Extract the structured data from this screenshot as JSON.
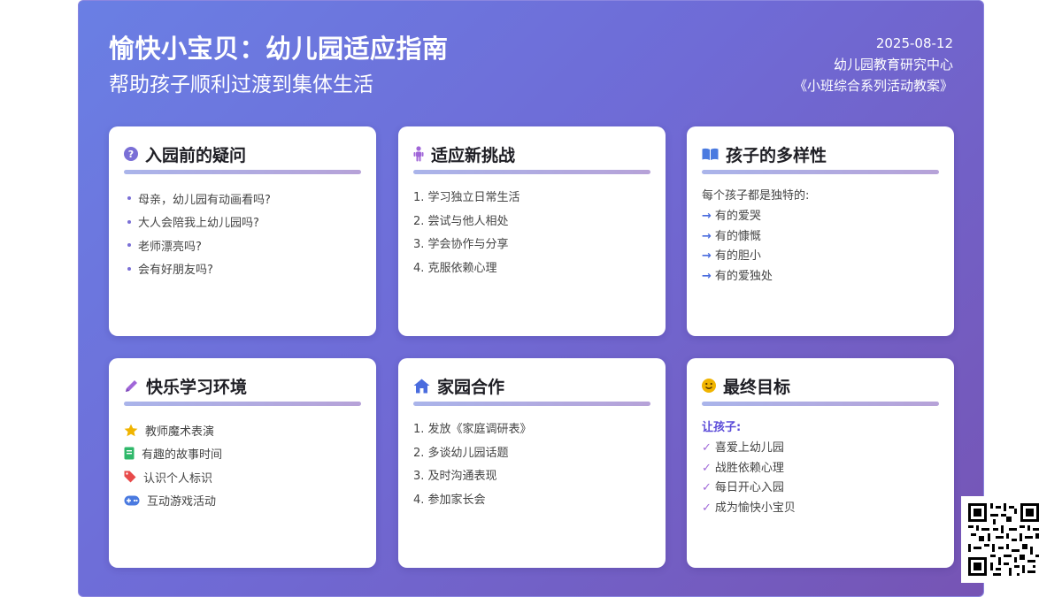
{
  "header": {
    "title": "愉快小宝贝：幼儿园适应指南",
    "subtitle": "帮助孩子顺利过渡到集体生活",
    "date": "2025-08-12",
    "org": "幼儿园教育研究中心",
    "series": "《小班综合系列活动教案》"
  },
  "colors": {
    "accent": "#6f6bd6",
    "gradient_start": "#6a7fe4",
    "gradient_end": "#7654b4"
  },
  "cards": [
    {
      "title": "入园前的疑问",
      "icon": "question-circle-icon",
      "items": [
        "母亲，幼儿园有动画看吗?",
        "大人会陪我上幼儿园吗?",
        "老师漂亮吗?",
        "会有好朋友吗?"
      ]
    },
    {
      "title": "适应新挑战",
      "icon": "child-icon",
      "items": [
        "1. 学习独立日常生活",
        "2. 尝试与他人相处",
        "3. 学会协作与分享",
        "4. 克服依赖心理"
      ]
    },
    {
      "title": "孩子的多样性",
      "icon": "book-open-icon",
      "lead": "每个孩子都是独特的:",
      "items": [
        "有的爱哭",
        "有的慷慨",
        "有的胆小",
        "有的爱独处"
      ]
    },
    {
      "title": "快乐学习环境",
      "icon": "pencil-icon",
      "items": [
        {
          "text": "教师魔术表演",
          "icon": "star-icon"
        },
        {
          "text": "有趣的故事时间",
          "icon": "book-icon"
        },
        {
          "text": "认识个人标识",
          "icon": "tag-icon"
        },
        {
          "text": "互动游戏活动",
          "icon": "gamepad-icon"
        }
      ]
    },
    {
      "title": "家园合作",
      "icon": "home-icon",
      "items": [
        "1. 发放《家庭调研表》",
        "2. 多谈幼儿园话题",
        "3. 及时沟通表现",
        "4. 参加家长会"
      ]
    },
    {
      "title": "最终目标",
      "icon": "smile-icon",
      "lead": "让孩子:",
      "items": [
        "喜爱上幼儿园",
        "战胜依赖心理",
        "每日开心入园",
        "成为愉快小宝贝"
      ]
    }
  ]
}
